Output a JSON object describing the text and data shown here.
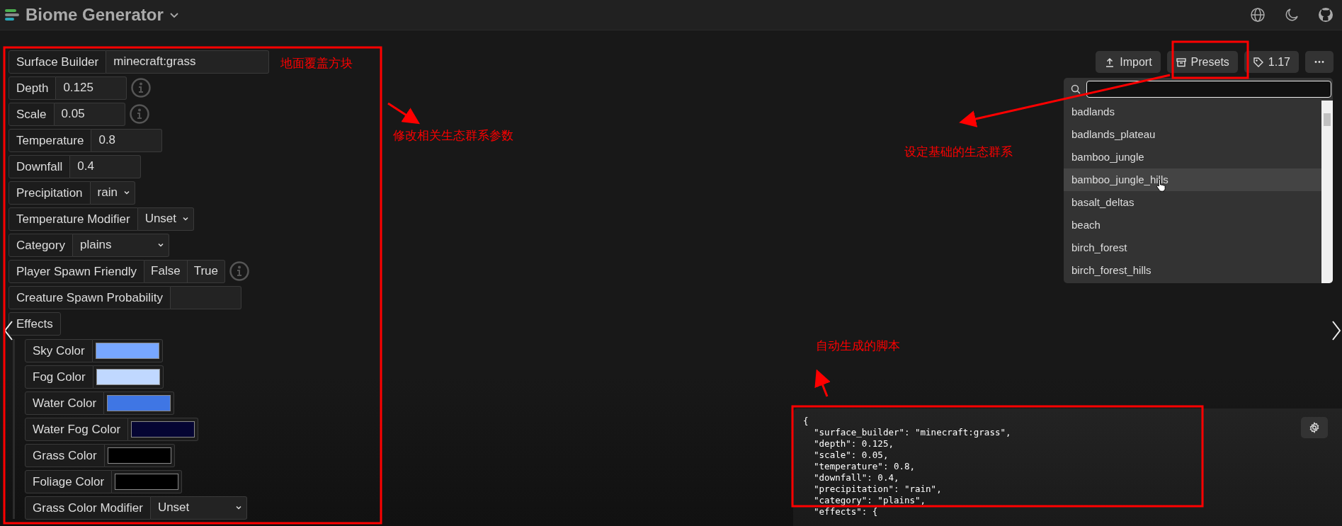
{
  "header": {
    "title": "Biome Generator"
  },
  "fields": [
    {
      "kind": "text",
      "label": "Surface Builder",
      "value": "minecraft:grass"
    },
    {
      "kind": "number",
      "label": "Depth",
      "value": "0.125",
      "info": true
    },
    {
      "kind": "number",
      "label": "Scale",
      "value": "0.05",
      "info": true
    },
    {
      "kind": "number",
      "label": "Temperature",
      "value": "0.8",
      "info": false
    },
    {
      "kind": "number",
      "label": "Downfall",
      "value": "0.4",
      "info": false
    },
    {
      "kind": "select",
      "label": "Precipitation",
      "value": "rain",
      "wide": false
    },
    {
      "kind": "select",
      "label": "Temperature Modifier",
      "value": "Unset",
      "wide": false
    },
    {
      "kind": "select",
      "label": "Category",
      "value": "plains",
      "wide": true
    },
    {
      "kind": "boolean",
      "label": "Player Spawn Friendly",
      "options": [
        {
          "label": "False",
          "selected": false
        },
        {
          "label": "True",
          "selected": false
        }
      ],
      "info": true
    },
    {
      "kind": "number",
      "label": "Creature Spawn Probability",
      "info": false
    },
    {
      "kind": "group",
      "label": "Effects",
      "children": [
        {
          "kind": "color",
          "label": "Sky Color",
          "color": "#78a7ff"
        },
        {
          "kind": "color",
          "label": "Fog Color",
          "color": "#c0d8ff"
        },
        {
          "kind": "color",
          "label": "Water Color",
          "color": "#3f76e4"
        },
        {
          "kind": "color",
          "label": "Water Fog Color",
          "color": "#050533"
        },
        {
          "kind": "color",
          "label": "Grass Color",
          "color": "#000000"
        },
        {
          "kind": "color",
          "label": "Foliage Color",
          "color": "#000000"
        },
        {
          "kind": "select",
          "label": "Grass Color Modifier",
          "value": "Unset",
          "wide": true
        }
      ]
    }
  ],
  "toolbar": [
    {
      "kind": "import",
      "label": "Import"
    },
    {
      "kind": "presets",
      "label": "Presets"
    },
    {
      "kind": "version",
      "label": "1.17"
    },
    {
      "kind": "more"
    }
  ],
  "presets": {
    "items": [
      {
        "label": "badlands",
        "hovered": false
      },
      {
        "label": "badlands_plateau",
        "hovered": false
      },
      {
        "label": "bamboo_jungle",
        "hovered": false
      },
      {
        "label": "bamboo_jungle_hills",
        "hovered": true
      },
      {
        "label": "basalt_deltas",
        "hovered": false
      },
      {
        "label": "beach",
        "hovered": false
      },
      {
        "label": "birch_forest",
        "hovered": false
      },
      {
        "label": "birch_forest_hills",
        "hovered": false
      }
    ]
  },
  "code": [
    "{",
    "  \"surface_builder\": \"minecraft:grass\",",
    "  \"depth\": 0.125,",
    "  \"scale\": 0.05,",
    "  \"temperature\": 0.8,",
    "  \"downfall\": 0.4,",
    "  \"precipitation\": \"rain\",",
    "  \"category\": \"plains\",",
    "  \"effects\": {"
  ],
  "annotations": [
    {
      "text": "地面覆盖方块"
    },
    {
      "text": "修改相关生态群系参数"
    },
    {
      "text": "设定基础的生态群系"
    },
    {
      "text": "自动生成的脚本"
    }
  ]
}
